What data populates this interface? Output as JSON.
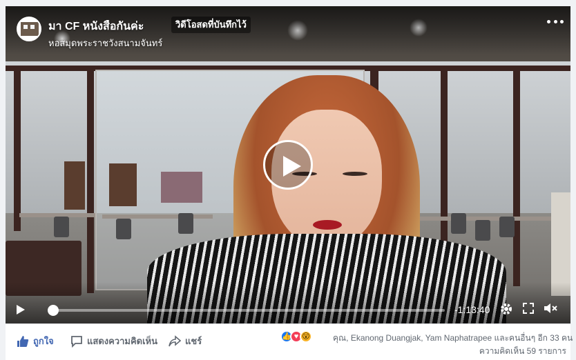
{
  "header": {
    "page_name": "มา CF หนังสือกันค่ะ",
    "live_badge": "วิดีโอสดที่บันทึกไว้",
    "location": "หอสมุดพระราชวังสนามจันทร์",
    "more_icon": "more-dots-icon"
  },
  "player": {
    "play_icon": "play-icon",
    "progress_fraction": 0.012,
    "time_remaining": "-1:13:40",
    "settings_icon": "gear-icon",
    "fullscreen_icon": "expand-icon",
    "volume_icon": "volume-muted-icon"
  },
  "actions": {
    "like_label": "ถูกใจ",
    "comment_label": "แสดงความคิดเห็น",
    "share_label": "แชร์"
  },
  "reactions": {
    "icons": [
      "like-reaction-icon",
      "love-reaction-icon",
      "wow-reaction-icon"
    ],
    "names_text": "คุณ, Ekanong Duangjak, Yam Naphatrapee และคนอื่นๆ อีก 33 คน",
    "comment_count_text": "ความคิดเห็น 59 รายการ"
  },
  "colors": {
    "accent": "#4267b2",
    "like_reaction": "#1877f2",
    "love_reaction": "#f33e58",
    "wow_reaction": "#f7b125"
  }
}
